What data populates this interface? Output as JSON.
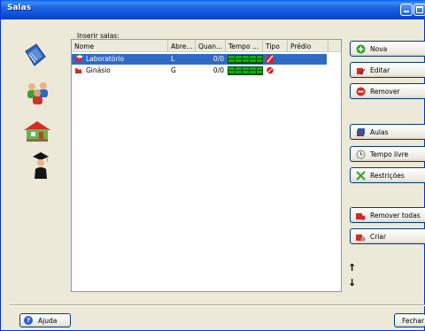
{
  "window": {
    "title": "Salas"
  },
  "list": {
    "caption": "Inserir salas:",
    "columns": [
      "Nome",
      "Abre...",
      "Quan...",
      "Tempo ...",
      "Tipo",
      "Prédio"
    ],
    "rows": [
      {
        "name": "Laboratório",
        "abrev": "L",
        "quant": "0/0",
        "selected": true,
        "tipo_color": "#E32020"
      },
      {
        "name": "Ginásio",
        "abrev": "G",
        "quant": "0/0",
        "selected": false,
        "tipo_color": "#D81E1E"
      }
    ]
  },
  "buttons": {
    "nova": "Nova",
    "editar": "Editar",
    "remover": "Remover",
    "aulas": "Aulas",
    "tempo_livre": "Tempo livre",
    "restricoes": "Restrições",
    "remover_todas": "Remover todas",
    "criar": "Criar"
  },
  "nav": {
    "up": "↑",
    "down": "↓"
  },
  "footer": {
    "help": "Ajuda",
    "help_icon": "?",
    "close": "Fechar"
  },
  "colors": {
    "title_bar": "#0B4ED8",
    "selection": "#316AC5",
    "meter": "#0CB20C"
  }
}
